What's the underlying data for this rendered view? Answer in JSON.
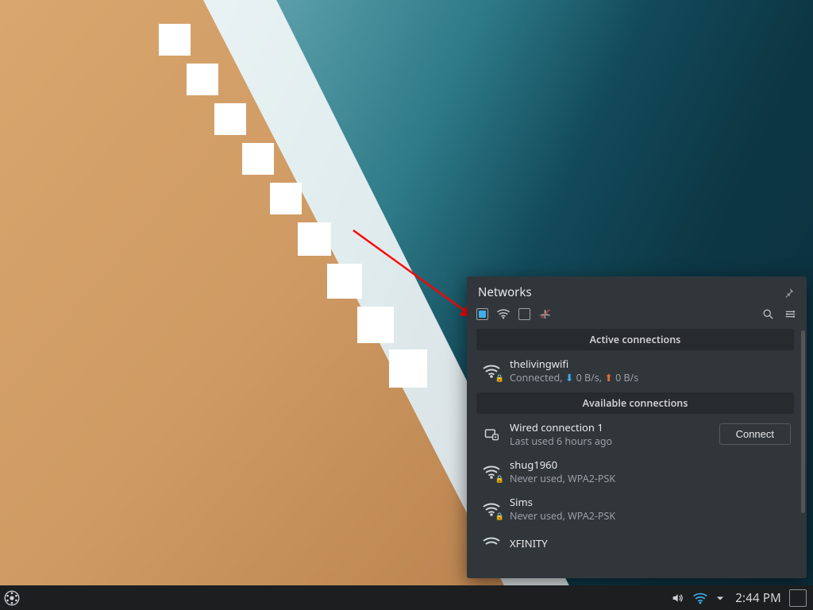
{
  "popup": {
    "title": "Networks",
    "toggles": {
      "wired_enabled": true,
      "wifi_enabled": true,
      "mobile_enabled": false,
      "airplane_enabled": false
    },
    "sections": {
      "active": "Active connections",
      "available": "Available connections"
    },
    "connect_label": "Connect",
    "active": [
      {
        "name": "thelivingwifi",
        "status_prefix": "Connected, ",
        "down": "0 B/s",
        "up": "0 B/s",
        "secure": true,
        "type": "wifi"
      }
    ],
    "available": [
      {
        "name": "Wired connection 1",
        "sub": "Last used 6 hours ago",
        "type": "wired",
        "secure": false,
        "show_connect": true
      },
      {
        "name": "shug1960",
        "sub": "Never used, WPA2-PSK",
        "type": "wifi",
        "secure": true,
        "show_connect": false
      },
      {
        "name": "Sims",
        "sub": "Never used, WPA2-PSK",
        "type": "wifi",
        "secure": true,
        "show_connect": false
      },
      {
        "name": "XFINITY",
        "sub": "",
        "type": "wifi",
        "secure": false,
        "show_connect": false
      }
    ]
  },
  "panel": {
    "clock": "2:44 PM"
  },
  "colors": {
    "accent": "#3daee9",
    "panel": "#1c1e20",
    "popup": "#31363b"
  }
}
